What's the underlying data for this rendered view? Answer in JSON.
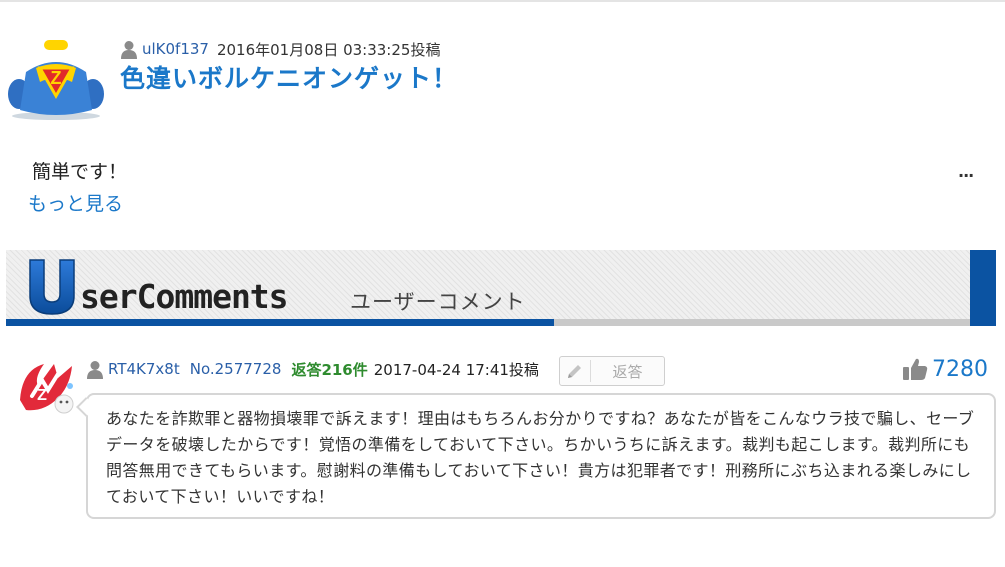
{
  "post": {
    "username": "ulK0f137",
    "posted": "2016年01月08日 03:33:25投稿",
    "title": "色違いボルケニオンゲット！",
    "body": "簡単です！",
    "more_link": "もっと見る",
    "menu": "..."
  },
  "banner": {
    "logo_text": "serComments",
    "logo_letter": "U",
    "subtitle": "ユーザーコメント"
  },
  "comment": {
    "username": "RT4K7x8t",
    "number": "No.2577728",
    "replies": "返答216件",
    "date": "2017-04-24 17:41投稿",
    "reply_button": "返答",
    "likes": "7280",
    "text": "あなたを詐欺罪と器物損壊罪で訴えます！理由はもちろんお分かりですね？あなたが皆をこんなウラ技で騙し、セーブデータを破壊したからです！覚悟の準備をしておいて下さい。ちかいうちに訴えます。裁判も起こします。裁判所にも問答無用できてもらいます。慰謝料の準備もしておいて下さい！貴方は犯罪者です！刑務所にぶち込まれる楽しみにしておいて下さい！いいですね！"
  },
  "colors": {
    "link_blue": "#1b78c9",
    "brand_navy": "#0b53a2",
    "reply_green": "#2e8b2e"
  },
  "icons": [
    "user-icon",
    "pencil-icon",
    "thumbs-up-icon"
  ]
}
